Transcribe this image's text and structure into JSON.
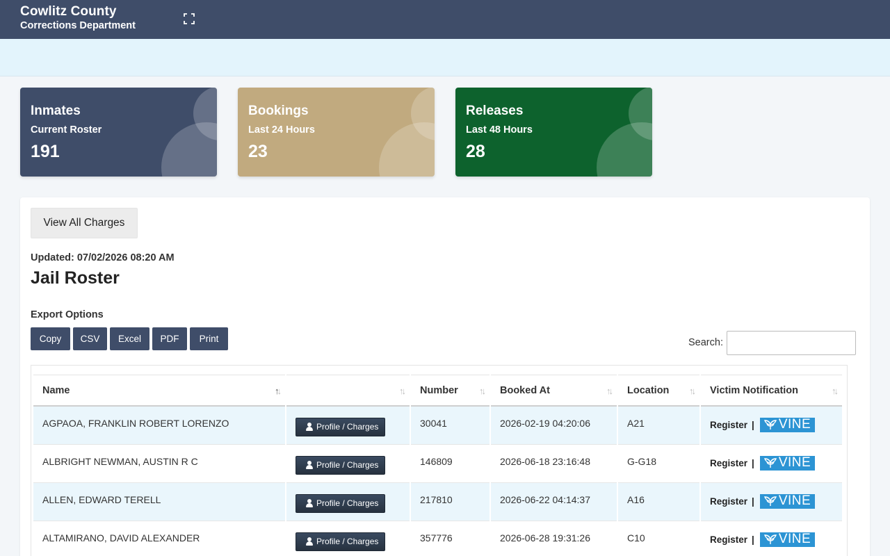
{
  "header": {
    "title": "Cowlitz County",
    "subtitle": "Corrections Department",
    "fullscreen_icon": "expand-icon"
  },
  "cards": [
    {
      "title": "Inmates",
      "subtitle": "Current Roster",
      "value": "191",
      "color": "#3f4d69"
    },
    {
      "title": "Bookings",
      "subtitle": "Last 24 Hours",
      "value": "23",
      "color": "#c1aa7f"
    },
    {
      "title": "Releases",
      "subtitle": "Last 48 Hours",
      "value": "28",
      "color": "#0d622d"
    }
  ],
  "panel": {
    "view_all_label": "View All Charges",
    "updated": "Updated: 07/02/2026 08:20 AM",
    "title": "Jail Roster",
    "export_label": "Export Options",
    "export_buttons": [
      "Copy",
      "CSV",
      "Excel",
      "PDF",
      "Print"
    ],
    "search_label": "Search:",
    "search_value": ""
  },
  "table": {
    "columns": [
      "Name",
      "",
      "Number",
      "Booked At",
      "Location",
      "Victim Notification"
    ],
    "profile_label": "Profile / Charges",
    "register_label": "Register",
    "separator": "|",
    "vine_label": "VINE",
    "rows": [
      {
        "name": "AGPAOA, FRANKLIN ROBERT LORENZO",
        "number": "30041",
        "booked": "2026-02-19 04:20:06",
        "location": "A21"
      },
      {
        "name": "ALBRIGHT NEWMAN, AUSTIN R C",
        "number": "146809",
        "booked": "2026-06-18 23:16:48",
        "location": "G-G18"
      },
      {
        "name": "ALLEN, EDWARD TERELL",
        "number": "217810",
        "booked": "2026-06-22 04:14:37",
        "location": "A16"
      },
      {
        "name": "ALTAMIRANO, DAVID ALEXANDER",
        "number": "357776",
        "booked": "2026-06-28 19:31:26",
        "location": "C10"
      }
    ]
  }
}
